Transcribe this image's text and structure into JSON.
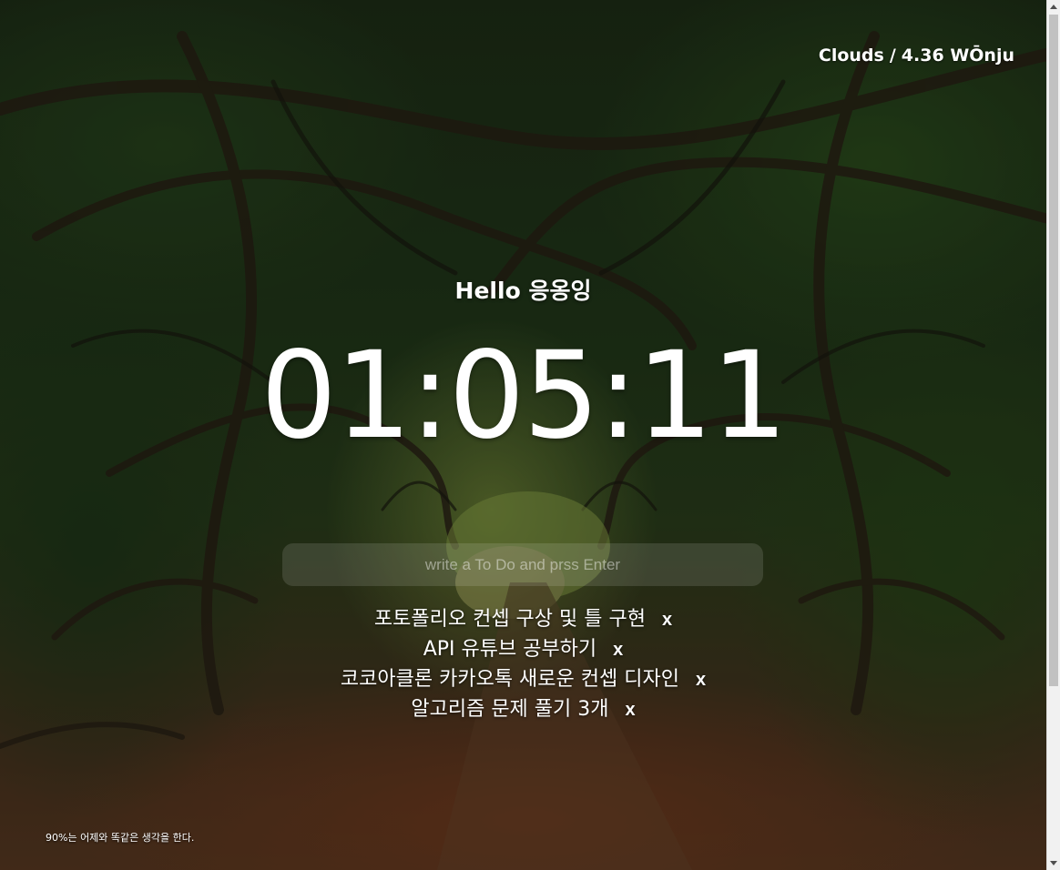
{
  "weather": {
    "condition": "Clouds",
    "separator": "/",
    "temperature": "4.36",
    "city": "WŌnju"
  },
  "greeting": {
    "text": "Hello 응옹잉"
  },
  "clock": {
    "time": "01:05:11"
  },
  "todo_form": {
    "placeholder": "write a To Do and prss Enter",
    "value": ""
  },
  "todos": [
    {
      "text": "포토폴리오 컨셉 구상 및 틀 구현",
      "delete_label": "x"
    },
    {
      "text": "API 유튜브 공부하기",
      "delete_label": "x"
    },
    {
      "text": "코코아클론 카카오톡 새로운 컨셉 디자인",
      "delete_label": "x"
    },
    {
      "text": "알고리즘 문제 풀기 3개",
      "delete_label": "x"
    }
  ],
  "quote": {
    "text": "90%는 어제와 똑같은 생각을 한다."
  },
  "background": {
    "scene": "forest-tunnel-path",
    "overlay_color": "#000000",
    "text_color": "#ffffff"
  }
}
